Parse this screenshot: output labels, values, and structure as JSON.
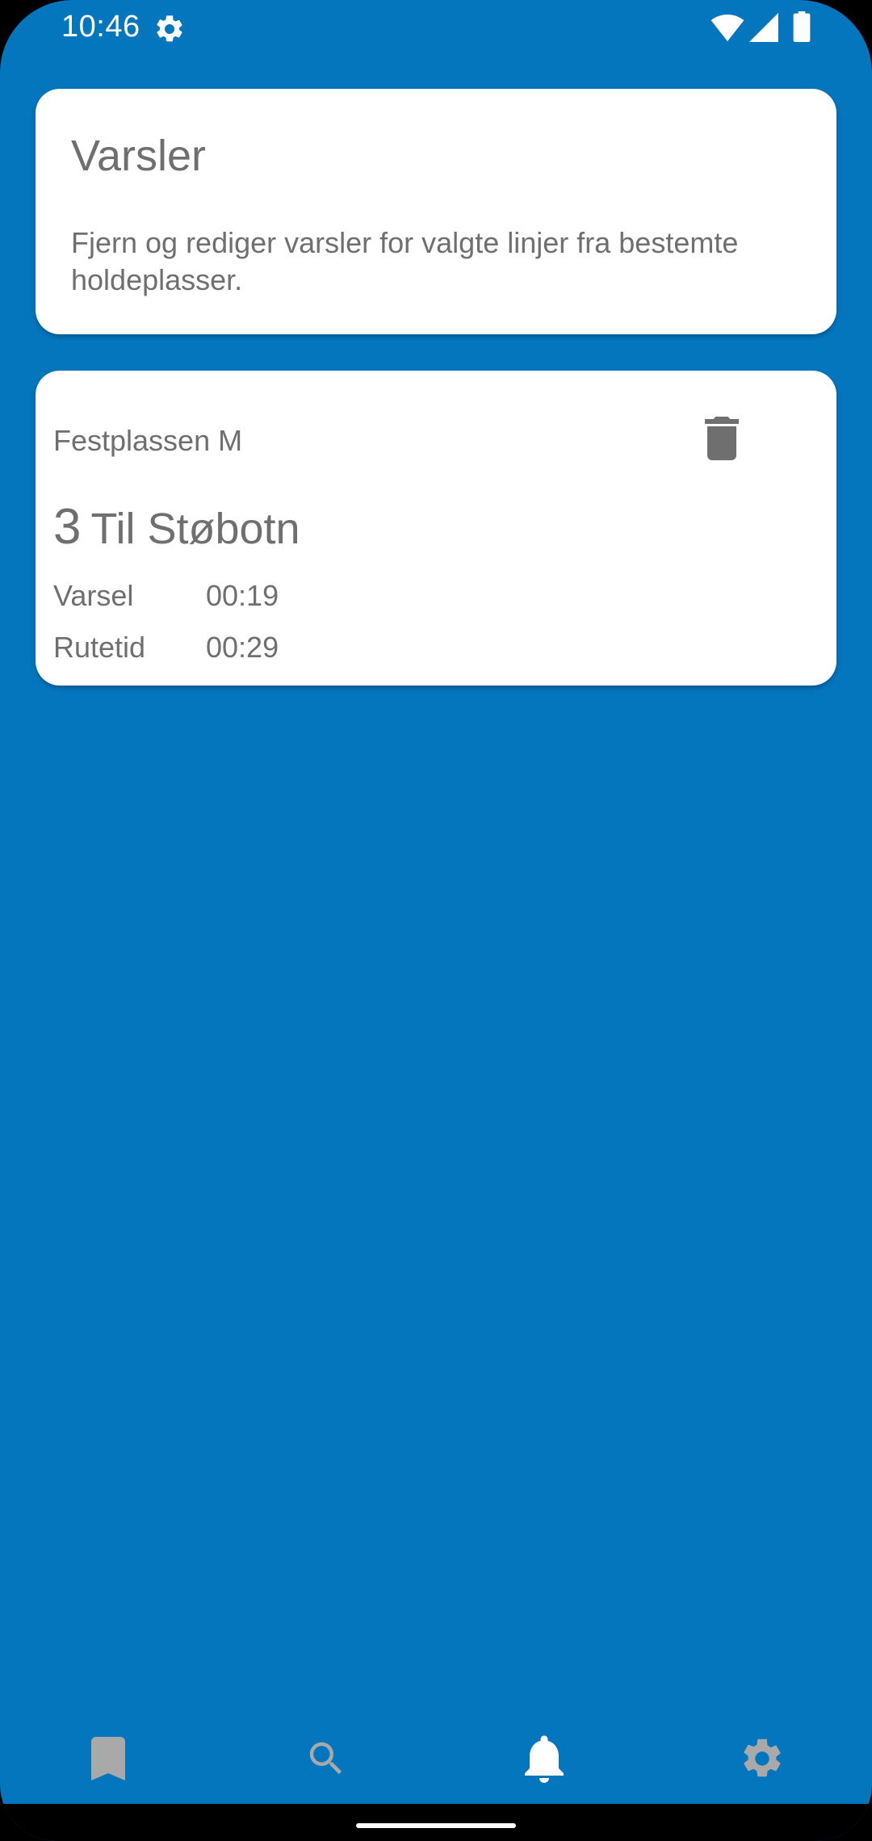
{
  "status_bar": {
    "time": "10:46",
    "icons": [
      "gear-icon",
      "wifi-icon",
      "signal-icon",
      "battery-icon"
    ]
  },
  "header_card": {
    "title": "Varsler",
    "description": "Fjern og rediger varsler for valgte linjer fra bestemte holdeplasser."
  },
  "alerts": [
    {
      "stop_name": "Festplassen M",
      "line_number": "3",
      "destination": "Til Støbotn",
      "varsel_label": "Varsel",
      "varsel_value": "00:19",
      "rutetid_label": "Rutetid",
      "rutetid_value": "00:29",
      "delete_icon": "trash-icon"
    }
  ],
  "bottom_nav": {
    "items": [
      {
        "icon": "bookmark-icon",
        "active": false
      },
      {
        "icon": "search-icon",
        "active": false
      },
      {
        "icon": "bell-icon",
        "active": true
      },
      {
        "icon": "gear-icon",
        "active": false
      }
    ]
  },
  "colors": {
    "background": "#0476BE",
    "card": "#FFFFFF",
    "text_secondary": "#6F6F6F",
    "nav_inactive": "#A9A9A9",
    "nav_active": "#FFFFFF"
  }
}
